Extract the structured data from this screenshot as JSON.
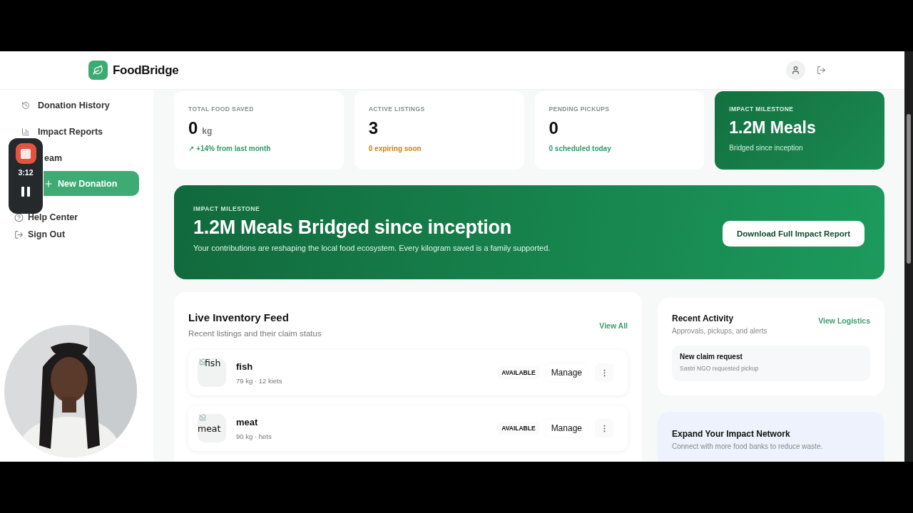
{
  "header": {
    "brand": "FoodBridge"
  },
  "sidebar": {
    "items": [
      {
        "label": "Donation History"
      },
      {
        "label": "Impact Reports"
      },
      {
        "label": "eam"
      }
    ],
    "primary_button": "New Donation",
    "footer_items": [
      {
        "label": "Help Center"
      },
      {
        "label": "Sign Out"
      }
    ]
  },
  "stats": [
    {
      "kind": "plain",
      "label": "TOTAL FOOD SAVED",
      "value": "0",
      "unit": "kg",
      "note": "↗ +14% from last month",
      "color": "#2e9a68"
    },
    {
      "kind": "plain",
      "label": "ACTIVE LISTINGS",
      "value": "3",
      "note": "0 expiring soon",
      "color": "#c9821c"
    },
    {
      "kind": "plain",
      "label": "PENDING PICKUPS",
      "value": "0",
      "note": "0 scheduled today",
      "color": "#2e9a68"
    },
    {
      "kind": "highlight",
      "label": "IMPACT MILESTONE",
      "value": "1.2M Meals",
      "note": "Bridged since inception",
      "color": "#d6efe2"
    }
  ],
  "banner": {
    "eyebrow": "IMPACT MILESTONE",
    "title": "1.2M Meals Bridged since inception",
    "text": "Your contributions are reshaping the local food ecosystem. Every kilogram saved is a family supported.",
    "button": "Download Full Impact Report"
  },
  "inventory": {
    "title": "Live Inventory Feed",
    "subtitle": "Recent listings and their claim status",
    "link": "View All",
    "items": [
      {
        "image_alt": "fish",
        "name": "fish",
        "meta": "79 kg · 12 kiets",
        "status": "AVAILABLE",
        "action": "Manage"
      },
      {
        "image_alt": "meat",
        "name": "meat",
        "meta": "90 kg · hets",
        "status": "AVAILABLE",
        "action": "Manage"
      }
    ]
  },
  "activity": {
    "title": "Recent Activity",
    "subtitle": "Approvals, pickups, and alerts",
    "link": "View Logistics",
    "items": [
      {
        "title": "New claim request",
        "text": "Sastri NGO requested pickup"
      }
    ]
  },
  "network": {
    "title": "Expand Your Impact Network",
    "text": "Connect with more food banks to reduce waste."
  },
  "recorder": {
    "time": "3:12"
  }
}
